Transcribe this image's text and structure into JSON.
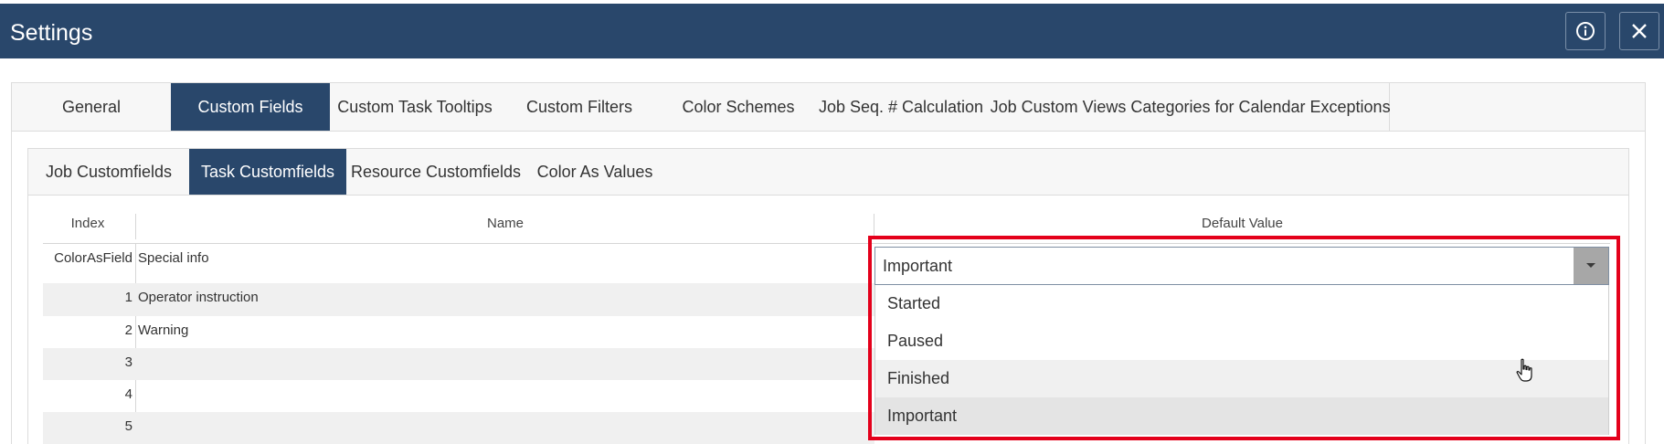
{
  "window": {
    "title": "Settings"
  },
  "main_tabs": [
    {
      "label": "General"
    },
    {
      "label": "Custom Fields"
    },
    {
      "label": "Custom Task Tooltips"
    },
    {
      "label": "Custom Filters"
    },
    {
      "label": "Color Schemes"
    },
    {
      "label": "Job Seq. # Calculation"
    },
    {
      "label": "Job Custom Views"
    },
    {
      "label": "Categories for Calendar Exceptions"
    }
  ],
  "sub_tabs": [
    {
      "label": "Job Customfields"
    },
    {
      "label": "Task Customfields"
    },
    {
      "label": "Resource Customfields"
    },
    {
      "label": "Color As Values"
    }
  ],
  "grid": {
    "columns": {
      "index": "Index",
      "name": "Name",
      "default_value": "Default Value"
    },
    "rows": [
      {
        "index": "ColorAsField",
        "name": "Special info"
      },
      {
        "index": "1",
        "name": "Operator instruction"
      },
      {
        "index": "2",
        "name": "Warning"
      },
      {
        "index": "3",
        "name": ""
      },
      {
        "index": "4",
        "name": ""
      },
      {
        "index": "5",
        "name": ""
      }
    ]
  },
  "default_value_combo": {
    "value": "Important",
    "options": [
      "Started",
      "Paused",
      "Finished",
      "Important"
    ]
  },
  "icons": {
    "info": "info-icon",
    "close": "close-icon",
    "dropdown": "caret-down-icon",
    "cursor": "hand-pointer-icon"
  },
  "colors": {
    "header_bg": "#29476b",
    "highlight": "#e4001b"
  }
}
